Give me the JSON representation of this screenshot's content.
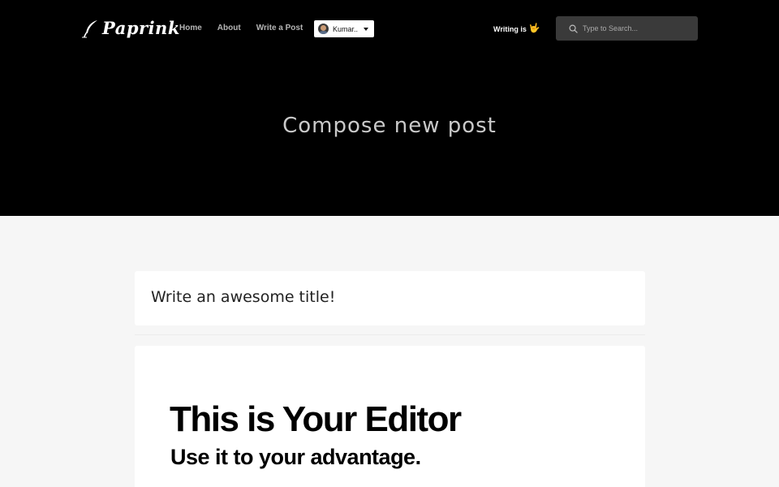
{
  "header": {
    "logo_text": "Paprink",
    "nav": [
      {
        "label": "Home"
      },
      {
        "label": "About"
      },
      {
        "label": "Write a Post"
      }
    ],
    "user_menu": {
      "name": "Kumar.."
    },
    "tagline": "Writing is",
    "tagline_emoji": "🤟",
    "search": {
      "placeholder": "Type to Search..."
    }
  },
  "hero": {
    "title": "Compose new post"
  },
  "editor": {
    "title_placeholder": "Write an awesome title!",
    "heading": "This is Your Editor",
    "subheading": "Use it to your advantage."
  }
}
